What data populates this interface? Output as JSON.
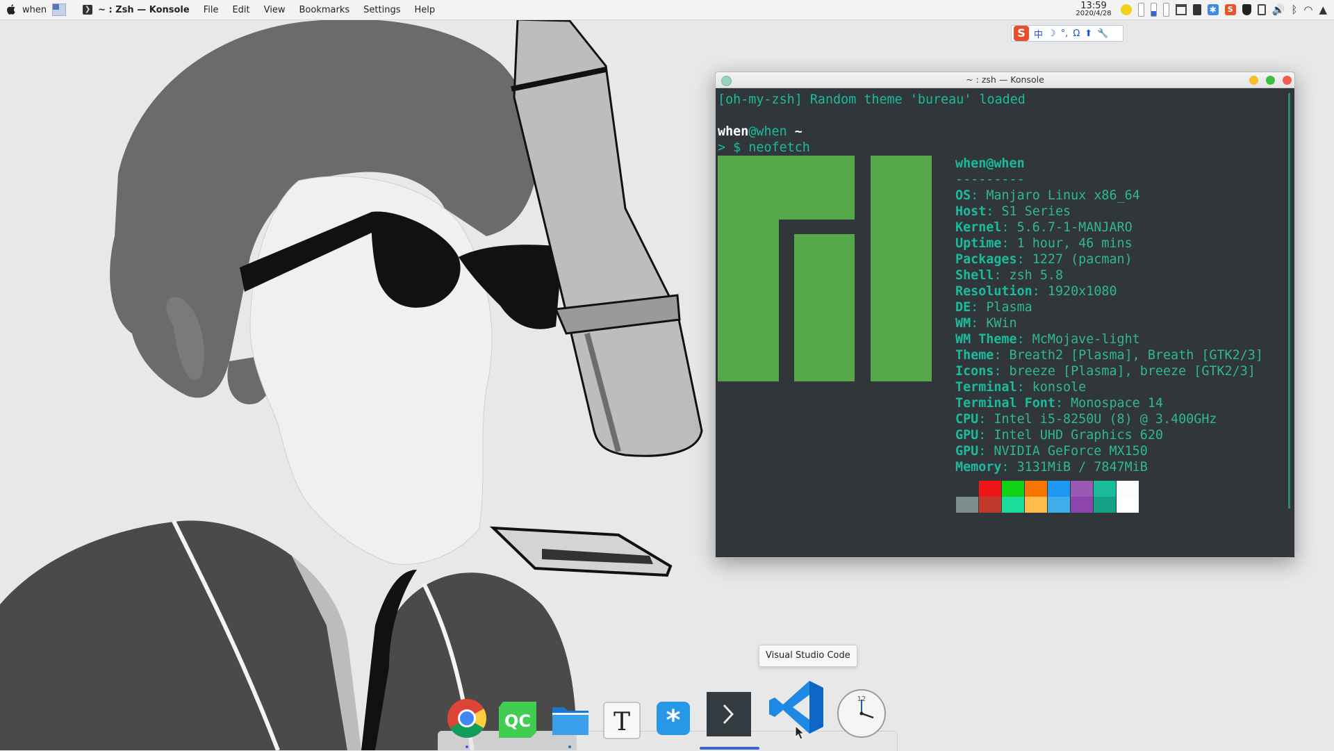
{
  "top_panel": {
    "user": "when",
    "active_app": "~ : Zsh — Konsole",
    "menus": [
      "File",
      "Edit",
      "View",
      "Bookmarks",
      "Settings",
      "Help"
    ],
    "clock_time": "13:59",
    "clock_date": "2020/4/28"
  },
  "ime_bar": {
    "logo": "S",
    "items": [
      "中",
      "☽",
      "°,",
      "Ω",
      "⬆",
      "🔧"
    ]
  },
  "konsole": {
    "title": "~ : zsh — Konsole",
    "line1": "[oh-my-zsh] Random theme 'bureau' loaded",
    "prompt_user": "when",
    "prompt_at": "@",
    "prompt_host": "when",
    "prompt_path": " ~",
    "prompt_symbol": "> $ ",
    "command": "neofetch",
    "info_header": "when@when",
    "info_separator": "---------",
    "info": [
      {
        "key": "OS",
        "value": "Manjaro Linux x86_64"
      },
      {
        "key": "Host",
        "value": "S1 Series"
      },
      {
        "key": "Kernel",
        "value": "5.6.7-1-MANJARO"
      },
      {
        "key": "Uptime",
        "value": "1 hour, 46 mins"
      },
      {
        "key": "Packages",
        "value": "1227 (pacman)"
      },
      {
        "key": "Shell",
        "value": "zsh 5.8"
      },
      {
        "key": "Resolution",
        "value": "1920x1080"
      },
      {
        "key": "DE",
        "value": "Plasma"
      },
      {
        "key": "WM",
        "value": "KWin"
      },
      {
        "key": "WM Theme",
        "value": "McMojave-light"
      },
      {
        "key": "Theme",
        "value": "Breath2 [Plasma], Breath [GTK2/3]"
      },
      {
        "key": "Icons",
        "value": "breeze [Plasma], breeze [GTK2/3]"
      },
      {
        "key": "Terminal",
        "value": "konsole"
      },
      {
        "key": "Terminal Font",
        "value": "Monospace 14"
      },
      {
        "key": "CPU",
        "value": "Intel i5-8250U (8) @ 3.400GHz"
      },
      {
        "key": "GPU",
        "value": "Intel UHD Graphics 620"
      },
      {
        "key": "GPU",
        "value": "NVIDIA GeForce MX150"
      },
      {
        "key": "Memory",
        "value": "3131MiB / 7847MiB"
      }
    ],
    "palette_top": [
      "#31363b",
      "#ed1515",
      "#11d116",
      "#f67400",
      "#1d99f3",
      "#9b59b6",
      "#1abc9c",
      "#fcfcfc"
    ],
    "palette_bottom": [
      "#7f8c8d",
      "#c0392b",
      "#1cdc9a",
      "#fdbc4b",
      "#3daee9",
      "#8e44ad",
      "#16a085",
      "#ffffff"
    ]
  },
  "tooltip": "Visual Studio Code",
  "dock": [
    "Google Chrome",
    "Qt Creator",
    "Files",
    "Typora",
    "Sogou",
    "Konsole",
    "Visual Studio Code",
    "Clock"
  ]
}
